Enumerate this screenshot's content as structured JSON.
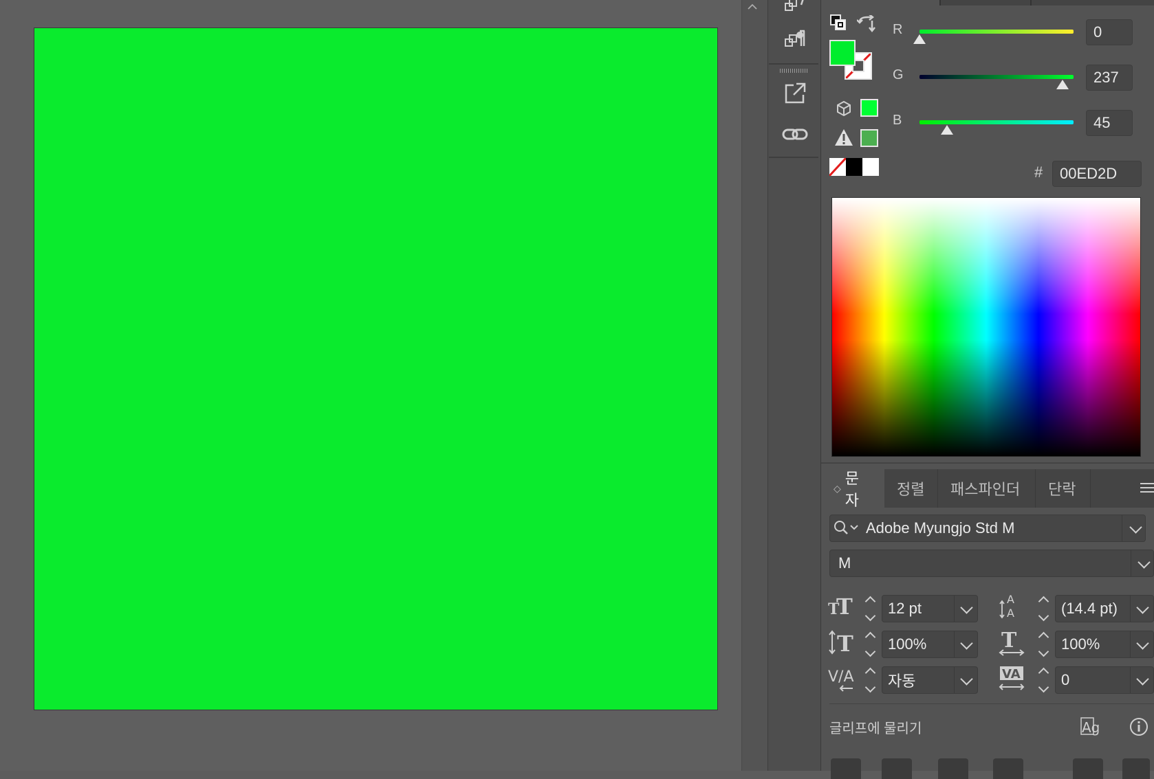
{
  "color": {
    "channels": [
      {
        "label": "R",
        "value": "0",
        "level": 0
      },
      {
        "label": "G",
        "value": "237",
        "level": 237
      },
      {
        "label": "B",
        "value": "45",
        "level": 45
      }
    ],
    "hex_symbol": "#",
    "hex_value": "00ED2D",
    "fill_color": "#00ED2D",
    "web_safe_color": "#00FF33",
    "gamut_color": "#4caf50"
  },
  "tabs": [
    {
      "label": "문자",
      "active": true
    },
    {
      "label": "정렬",
      "active": false
    },
    {
      "label": "패스파인더",
      "active": false
    },
    {
      "label": "단락",
      "active": false
    }
  ],
  "character": {
    "font_family": "Adobe Myungjo Std M",
    "font_style": "M",
    "font_size": "12 pt",
    "leading": "(14.4 pt)",
    "vertical_scale": "100%",
    "horizontal_scale": "100%",
    "kerning": "자동",
    "tracking": "0",
    "snap_to_glyph_label": "글리프에 물리기"
  },
  "artboard_color": "#0AEB2D"
}
